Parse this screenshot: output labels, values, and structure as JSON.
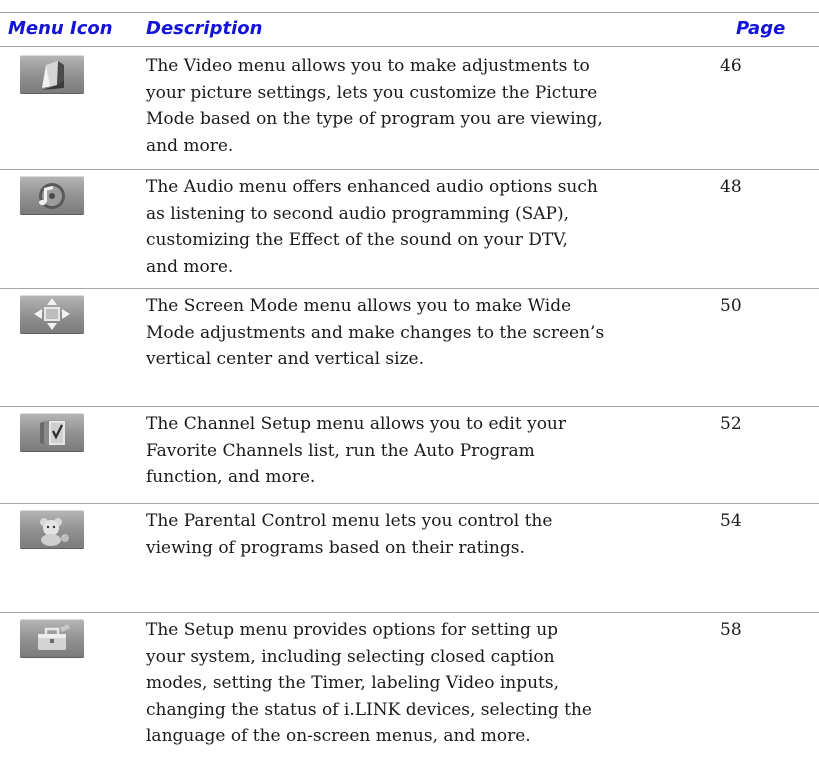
{
  "headers": {
    "icon": "Menu Icon",
    "description": "Description",
    "page": "Page"
  },
  "rows": [
    {
      "icon": "video-icon",
      "lines": [
        "The Video menu allows you to make adjustments to",
        "your picture settings, lets you customize the Picture",
        "Mode based on the type of program you are viewing,",
        "and more."
      ],
      "page": "46"
    },
    {
      "icon": "audio-icon",
      "lines": [
        "The Audio menu offers enhanced audio options such",
        "as listening to second audio programming (SAP),",
        "customizing the Effect of the sound on your DTV,",
        "and more."
      ],
      "page": "48"
    },
    {
      "icon": "screen-mode-icon",
      "lines": [
        "The Screen Mode menu allows you to make Wide",
        "Mode adjustments and make changes to the screen’s",
        "vertical center and vertical size."
      ],
      "page": "50"
    },
    {
      "icon": "channel-setup-icon",
      "lines": [
        "The Channel Setup menu allows you to edit your",
        "Favorite Channels list, run the Auto Program",
        "function, and more."
      ],
      "page": "52"
    },
    {
      "icon": "parental-control-icon",
      "lines": [
        "The Parental Control menu lets you control the",
        "viewing of programs based on their ratings."
      ],
      "page": "54"
    },
    {
      "icon": "setup-icon",
      "lines": [
        "The Setup menu provides options for  setting up",
        "your system, including selecting closed caption",
        "modes, setting the Timer, labeling Video inputs,",
        "changing the status of i.LINK devices, selecting the",
        "language of the on-screen menus, and more."
      ],
      "page": "58"
    }
  ]
}
